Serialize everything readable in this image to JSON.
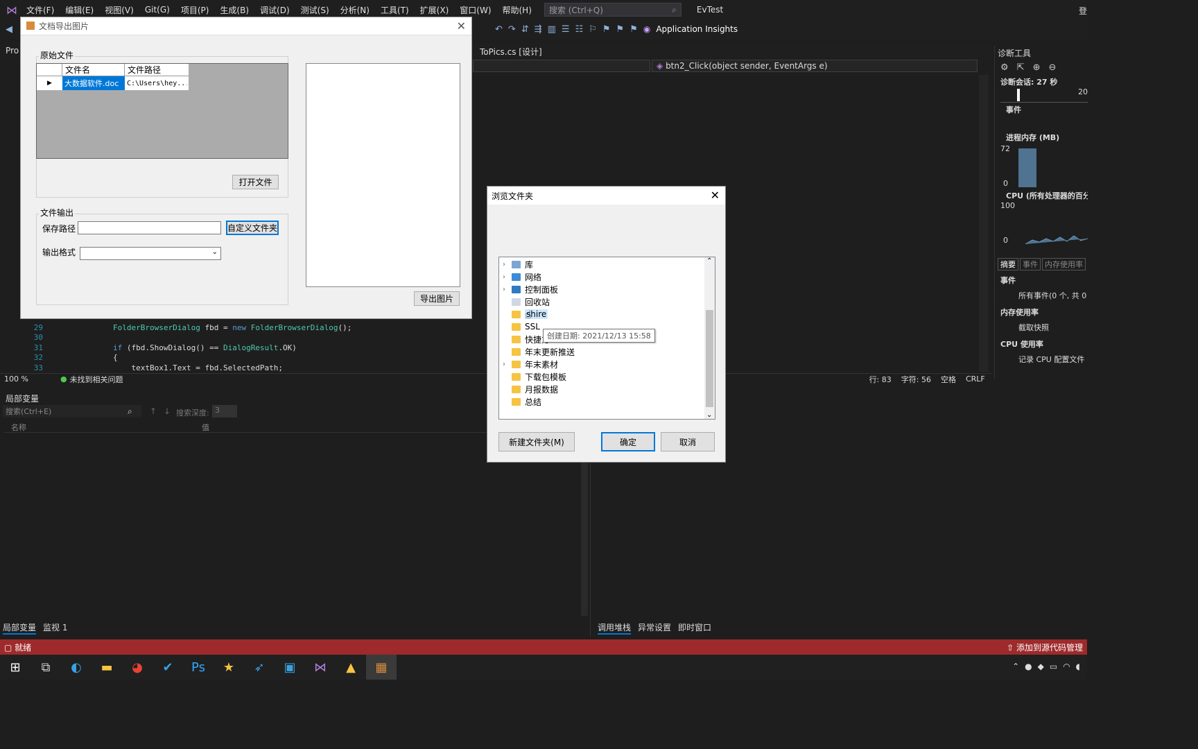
{
  "menubar": {
    "items": [
      "文件(F)",
      "编辑(E)",
      "视图(V)",
      "Git(G)",
      "项目(P)",
      "生成(B)",
      "调试(D)",
      "测试(S)",
      "分析(N)",
      "工具(T)",
      "扩展(X)",
      "窗口(W)",
      "帮助(H)"
    ],
    "search_placeholder": "搜索 (Ctrl+Q)",
    "solution_name": "EvTest",
    "login": "登"
  },
  "toolbar": {
    "insights": "Application Insights"
  },
  "editor": {
    "left_tab": "Pro",
    "tab": "ToPics.cs [设计]",
    "method_dropdown": "btn2_Click(object sender, EventArgs e)",
    "lines": [
      {
        "n": "29",
        "text": "FolderBrowserDialog fbd = new FolderBrowserDialog();"
      },
      {
        "n": "30",
        "text": ""
      },
      {
        "n": "31",
        "text": "if (fbd.ShowDialog() == DialogResult.OK)"
      },
      {
        "n": "32",
        "text": "{"
      },
      {
        "n": "33",
        "text": "    textBox1.Text = fbd.SelectedPath;"
      }
    ],
    "zoom": "100 %",
    "issues": "未找到相关问题",
    "row": "行: 83",
    "col": "字符: 56",
    "spaces": "空格",
    "eol": "CRLF"
  },
  "locals": {
    "title": "局部变量",
    "search_placeholder": "搜索(Ctrl+E)",
    "depth_label": "搜索深度:",
    "depth_value": "3",
    "col_name": "名称",
    "col_value": "值",
    "tabs": [
      "局部变量",
      "监视 1"
    ]
  },
  "rightpanel_tabs": [
    "调用堆栈",
    "异常设置",
    "即时窗口"
  ],
  "diagnostics": {
    "title": "诊断工具",
    "session": "诊断会话: 27 秒",
    "timeline_mark": "20",
    "events": "事件",
    "memory": "进程内存 (MB)",
    "mem_max": "72",
    "mem_min": "0",
    "cpu": "CPU (所有处理器的百分",
    "cpu_max": "100",
    "cpu_min": "0",
    "tabs": [
      "摘要",
      "事件",
      "内存使用率"
    ],
    "sec_events": "事件",
    "all_events": "所有事件(0 个, 共 0",
    "sec_mem": "内存使用率",
    "snapshot": "截取快照",
    "sec_cpu": "CPU 使用率",
    "cpu_profile": "记录 CPU 配置文件"
  },
  "status": {
    "ready": "就绪",
    "source_control": "添加到源代码管理"
  },
  "winform": {
    "title": "文档导出图片",
    "group_source": "原始文件",
    "col_filename": "文件名",
    "col_filepath": "文件路径",
    "row_filename": "大数据软件.doc",
    "row_filepath": "C:\\Users\\hey...",
    "open_btn": "打开文件",
    "group_output": "文件输出",
    "save_path_label": "保存路径",
    "save_path_value": "",
    "custom_folder_btn": "自定义文件夹",
    "format_label": "输出格式",
    "format_value": "",
    "export_btn": "导出图片"
  },
  "folder_dialog": {
    "title": "浏览文件夹",
    "items": [
      {
        "label": "库",
        "expandable": true,
        "icon": "library"
      },
      {
        "label": "网络",
        "expandable": true,
        "icon": "network"
      },
      {
        "label": "控制面板",
        "expandable": true,
        "icon": "control-panel"
      },
      {
        "label": "回收站",
        "expandable": false,
        "icon": "recycle-bin"
      },
      {
        "label": "shire",
        "expandable": false,
        "icon": "folder"
      },
      {
        "label": "SSL",
        "expandable": false,
        "icon": "folder"
      },
      {
        "label": "快捷方",
        "expandable": false,
        "icon": "folder"
      },
      {
        "label": "年末更新推送",
        "expandable": false,
        "icon": "folder"
      },
      {
        "label": "年末素材",
        "expandable": true,
        "icon": "folder"
      },
      {
        "label": "下载包模板",
        "expandable": false,
        "icon": "folder"
      },
      {
        "label": "月报数据",
        "expandable": false,
        "icon": "folder"
      },
      {
        "label": "总结",
        "expandable": false,
        "icon": "folder"
      }
    ],
    "tooltip": "创建日期: 2021/12/13 15:58",
    "new_folder_btn": "新建文件夹(M)",
    "ok_btn": "确定",
    "cancel_btn": "取消"
  },
  "colors": {
    "status": "#9e2a2b",
    "accent": "#0078d7",
    "vs": "#b180d7"
  }
}
